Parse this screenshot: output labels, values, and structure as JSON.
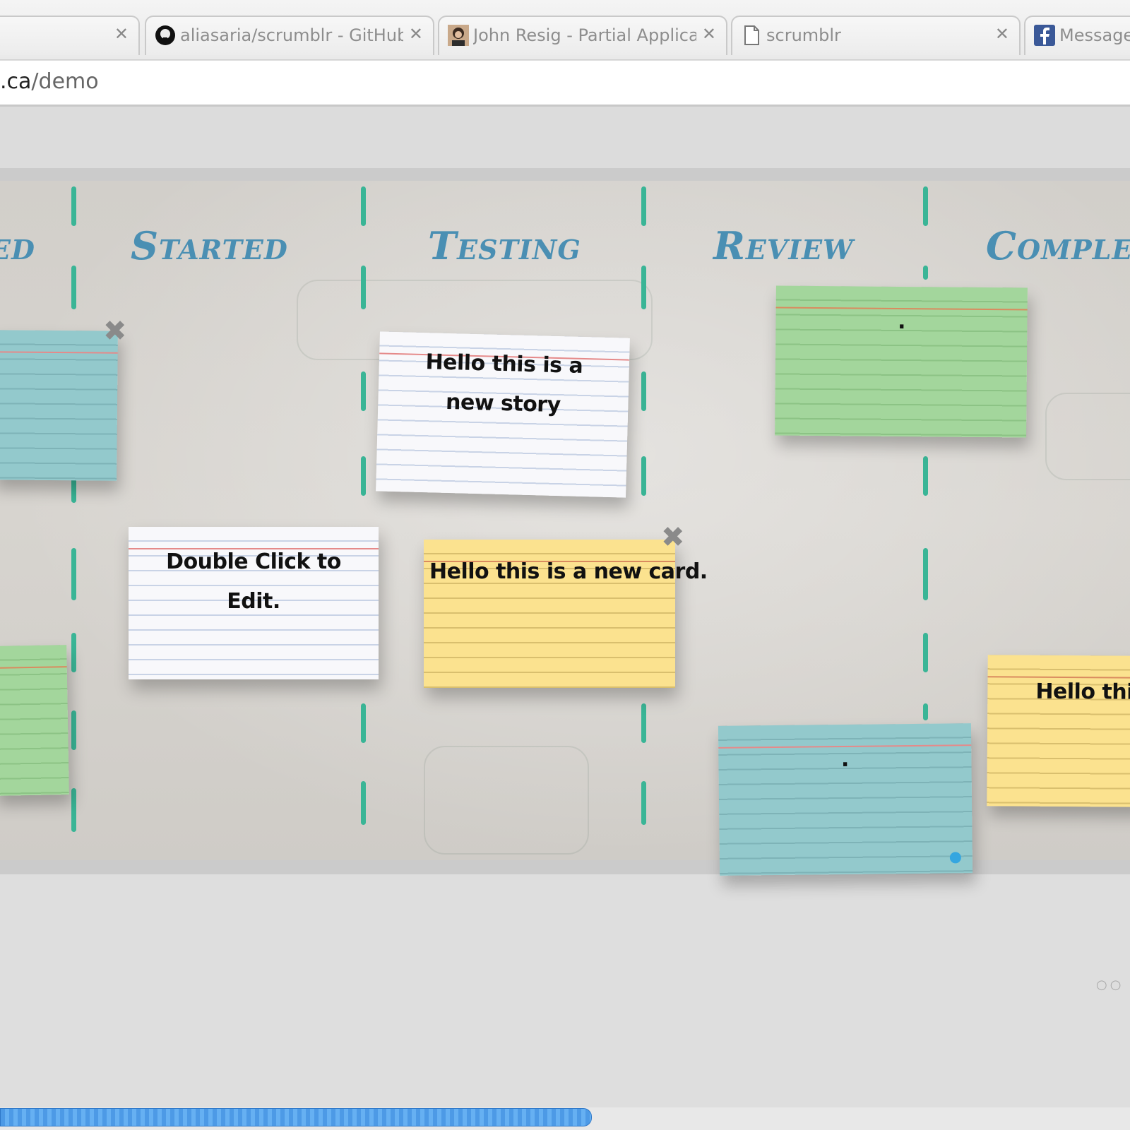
{
  "browser": {
    "tabs": [
      {
        "title": "",
        "favicon": "none"
      },
      {
        "title": "aliasaria/scrumblr - GitHub",
        "favicon": "github-icon"
      },
      {
        "title": "John Resig - Partial Applica",
        "favicon": "avatar-icon"
      },
      {
        "title": "scrumblr",
        "favicon": "page-icon"
      },
      {
        "title": "Messages",
        "favicon": "facebook-icon"
      }
    ],
    "close_glyph": "✕",
    "url_host": ".ca",
    "url_path": "/demo"
  },
  "board": {
    "columns": [
      {
        "title": "ed"
      },
      {
        "title": "Started"
      },
      {
        "title": "Testing"
      },
      {
        "title": "Review"
      },
      {
        "title": "Complet"
      }
    ],
    "cards": [
      {
        "id": "blue-left-top",
        "color": "blue",
        "text": ""
      },
      {
        "id": "green-left-bottom",
        "color": "green",
        "text": ""
      },
      {
        "id": "white-started",
        "color": "white",
        "text": "Double Click to Edit."
      },
      {
        "id": "white-testing",
        "color": "white",
        "text": "Hello this is a new story"
      },
      {
        "id": "yellow-testing",
        "color": "yellow",
        "text": "Hello this is a new card."
      },
      {
        "id": "green-review",
        "color": "green",
        "text": "."
      },
      {
        "id": "blue-review",
        "color": "blue",
        "text": "."
      },
      {
        "id": "yellow-complete",
        "color": "yellow",
        "text": "Hello this"
      }
    ],
    "delete_glyph": "✖"
  },
  "pager": "○○",
  "colors": {
    "title": "#4a8fb3",
    "divider": "#3ab596",
    "scroll_thumb": "#4d9ae6"
  }
}
